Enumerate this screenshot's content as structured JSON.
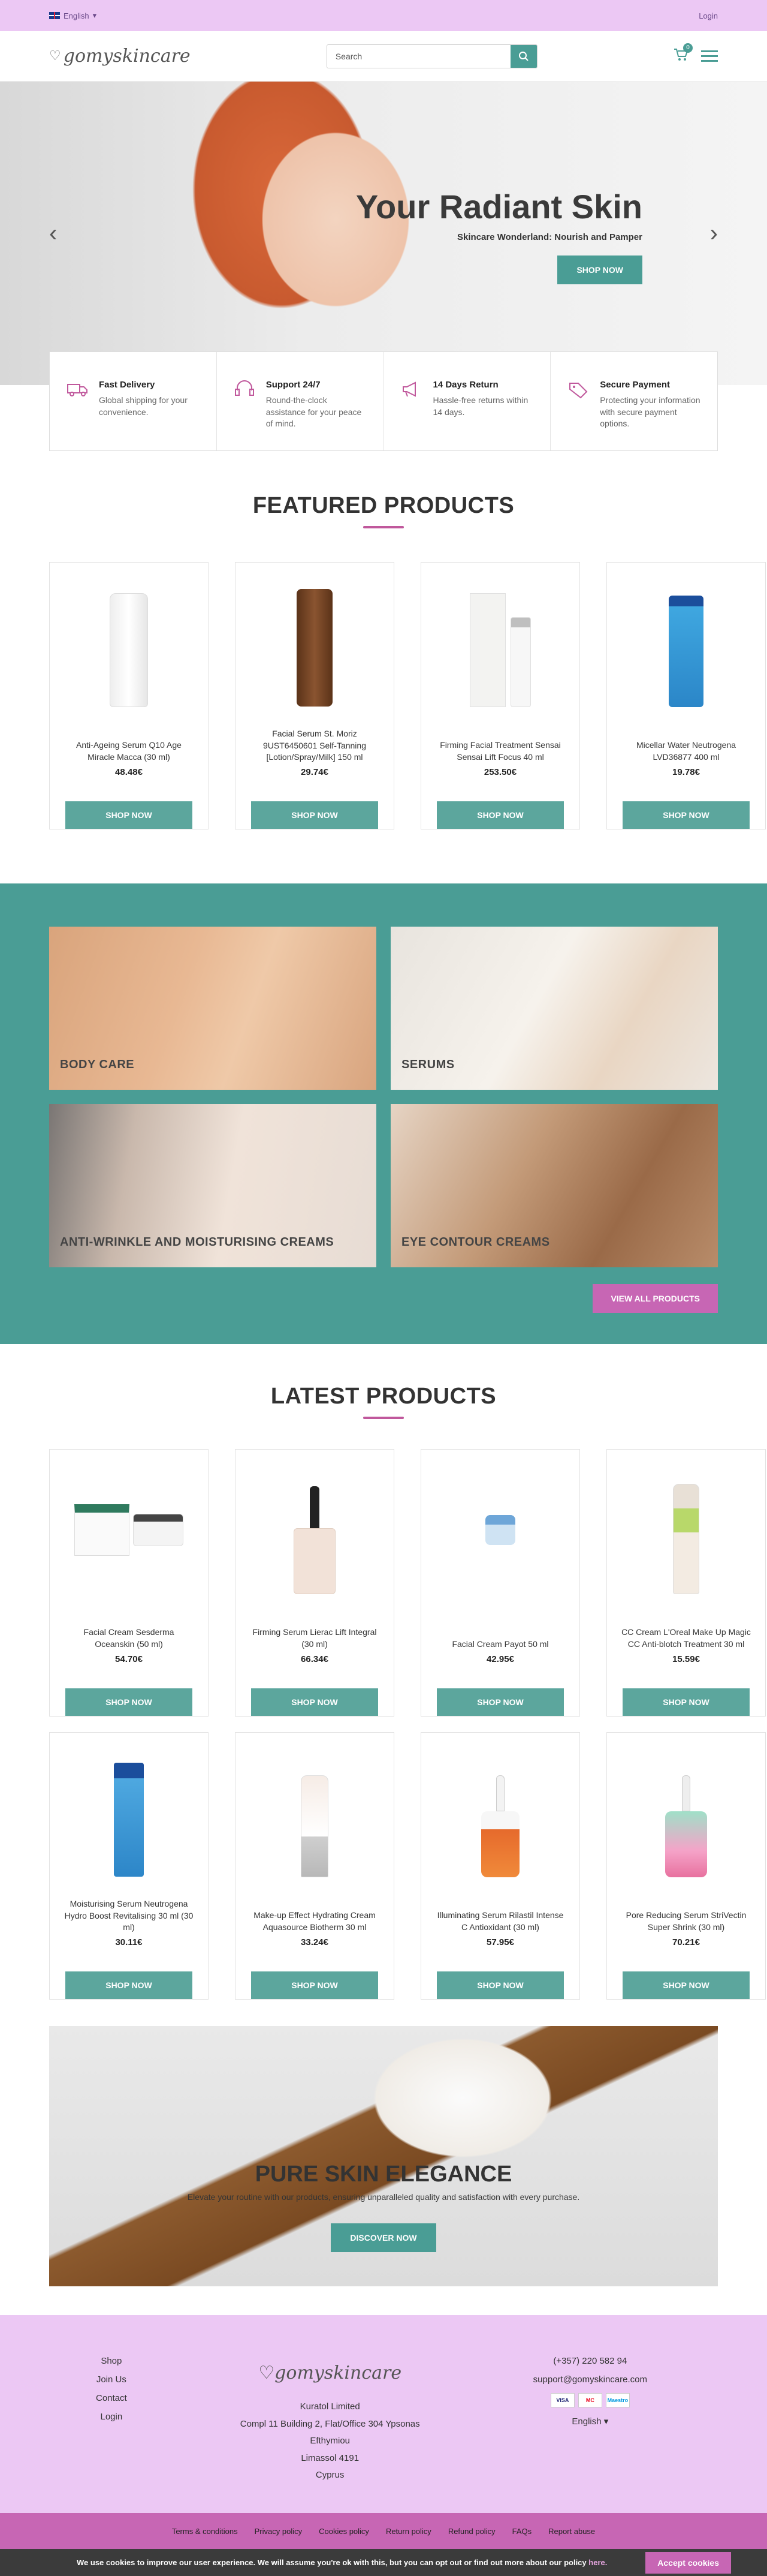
{
  "topbar": {
    "language": "English",
    "login": "Login"
  },
  "header": {
    "logo": "gomyskincare",
    "search": {
      "placeholder": "Search",
      "value": ""
    },
    "cart_count": "0"
  },
  "hero": {
    "title": "Your Radiant Skin",
    "subtitle": "Skincare Wonderland: Nourish and Pamper",
    "button": "SHOP NOW"
  },
  "features": [
    {
      "title": "Fast Delivery",
      "desc": "Global shipping for your convenience.",
      "icon": "truck-icon"
    },
    {
      "title": "Support 24/7",
      "desc": "Round-the-clock assistance for your peace of mind.",
      "icon": "headset-icon"
    },
    {
      "title": "14 Days Return",
      "desc": "Hassle-free returns within 14 days.",
      "icon": "megaphone-icon"
    },
    {
      "title": "Secure Payment",
      "desc": "Protecting your information with secure payment options.",
      "icon": "tag-icon"
    }
  ],
  "featured": {
    "title": "FEATURED PRODUCTS",
    "products": [
      {
        "name": "Anti-Ageing Serum Q10 Age Miracle Macca (30 ml)",
        "price": "48.48€",
        "button": "SHOP NOW"
      },
      {
        "name": "Facial Serum St. Moriz 9UST6450601 Self-Tanning [Lotion/Spray/Milk] 150 ml",
        "price": "29.74€",
        "button": "SHOP NOW"
      },
      {
        "name": "Firming Facial Treatment Sensai Sensai Lift Focus 40 ml",
        "price": "253.50€",
        "button": "SHOP NOW"
      },
      {
        "name": "Micellar Water Neutrogena LVD36877 400 ml",
        "price": "19.78€",
        "button": "SHOP NOW"
      }
    ]
  },
  "categories": {
    "items": [
      "BODY CARE",
      "SERUMS",
      "ANTI-WRINKLE AND MOISTURISING CREAMS",
      "EYE CONTOUR CREAMS"
    ],
    "view_all": "VIEW ALL PRODUCTS"
  },
  "latest": {
    "title": "LATEST PRODUCTS",
    "products": [
      {
        "name": "Facial Cream Sesderma Oceanskin (50 ml)",
        "price": "54.70€",
        "button": "SHOP NOW"
      },
      {
        "name": "Firming Serum Lierac Lift Integral (30 ml)",
        "price": "66.34€",
        "button": "SHOP NOW"
      },
      {
        "name": "Facial Cream Payot 50 ml",
        "price": "42.95€",
        "button": "SHOP NOW"
      },
      {
        "name": "CC Cream L'Oreal Make Up Magic CC Anti-blotch Treatment 30 ml",
        "price": "15.59€",
        "button": "SHOP NOW"
      },
      {
        "name": "Moisturising Serum Neutrogena Hydro Boost Revitalising 30 ml (30 ml)",
        "price": "30.11€",
        "button": "SHOP NOW"
      },
      {
        "name": "Make-up Effect Hydrating Cream Aquasource Biotherm 30 ml",
        "price": "33.24€",
        "button": "SHOP NOW"
      },
      {
        "name": "Illuminating Serum Rilastil Intense C Antioxidant (30 ml)",
        "price": "57.95€",
        "button": "SHOP NOW"
      },
      {
        "name": "Pore Reducing Serum StriVectin Super Shrink (30 ml)",
        "price": "70.21€",
        "button": "SHOP NOW"
      }
    ]
  },
  "banner": {
    "title": "PURE SKIN ELEGANCE",
    "subtitle": "Elevate your routine with our products, ensuring unparalleled quality and satisfaction with every purchase.",
    "button": "DISCOVER NOW"
  },
  "footer": {
    "links": [
      "Shop",
      "Join Us",
      "Contact",
      "Login"
    ],
    "logo": "gomyskincare",
    "company": "Kuratol Limited",
    "address1": "Compl 11 Building 2, Flat/Office 304 Ypsonas",
    "address2": "Efthymiou",
    "address3": "Limassol 4191",
    "address4": "Cyprus",
    "phone": "(+357) 220 582 94",
    "email": "support@gomyskincare.com",
    "language": "English",
    "payments": [
      "VISA",
      "MC",
      "Maestro"
    ]
  },
  "legal": [
    "Terms & conditions",
    "Privacy policy",
    "Cookies policy",
    "Return policy",
    "Refund policy",
    "FAQs",
    "Report abuse"
  ],
  "cookie": {
    "text": "We use cookies to improve our user experience. We will assume you're ok with this, but you can opt out or find out more about our policy",
    "link": "here.",
    "button": "Accept cookies"
  },
  "colors": {
    "teal": "#4a9d95",
    "pink": "#c766b4",
    "lilac": "#ecc8f4"
  }
}
